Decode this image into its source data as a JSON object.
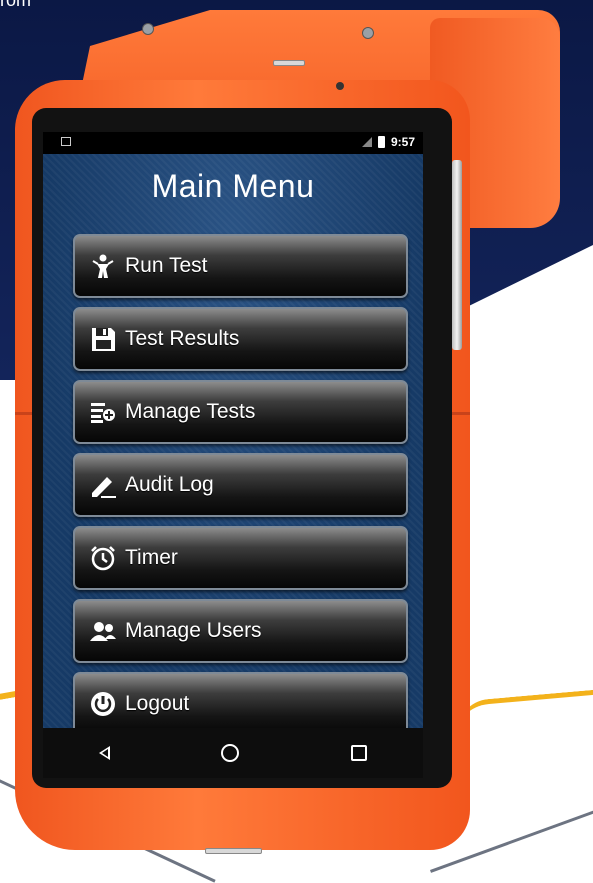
{
  "backdrop": {
    "caption": "rom",
    "navy": "#0b1845",
    "accent_yellow": "#f3b21b",
    "case_orange": "#f0561f"
  },
  "status_bar": {
    "time": "9:57",
    "left_icon": "image-icon",
    "right_icons": [
      "no-signal-icon",
      "battery-icon"
    ]
  },
  "screen": {
    "title": "Main Menu",
    "background": "#163a66"
  },
  "menu": {
    "items": [
      {
        "label": "Run Test",
        "icon": "running-person-icon"
      },
      {
        "label": "Test Results",
        "icon": "floppy-disk-icon"
      },
      {
        "label": "Manage Tests",
        "icon": "list-add-icon"
      },
      {
        "label": "Audit Log",
        "icon": "pen-icon"
      },
      {
        "label": "Timer",
        "icon": "alarm-clock-icon"
      },
      {
        "label": "Manage Users",
        "icon": "users-icon"
      },
      {
        "label": "Logout",
        "icon": "power-icon"
      }
    ]
  },
  "nav_bar": {
    "buttons": [
      "back-icon",
      "home-icon",
      "recents-icon"
    ]
  }
}
